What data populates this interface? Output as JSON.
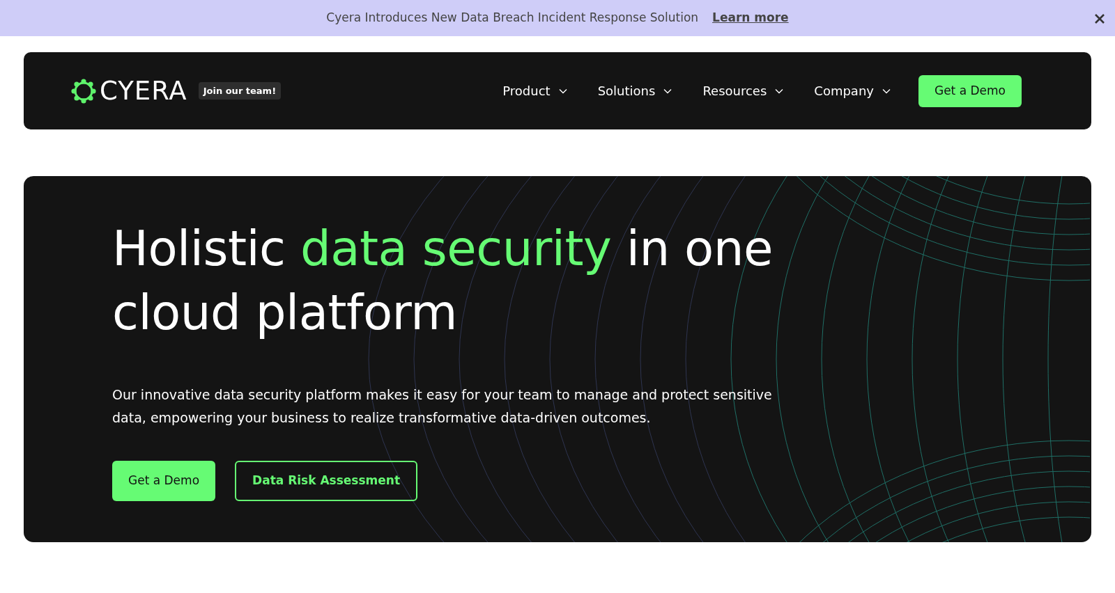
{
  "announcement": {
    "text": "Cyera Introduces New Data Breach Incident Response Solution",
    "link": "Learn more"
  },
  "nav": {
    "logo": "CYERA",
    "badge": "Join our team!",
    "items": [
      {
        "label": "Product"
      },
      {
        "label": "Solutions"
      },
      {
        "label": "Resources"
      },
      {
        "label": "Company"
      }
    ],
    "cta": "Get a Demo"
  },
  "hero": {
    "headline": [
      {
        "text": "Holistic ",
        "highlight": false
      },
      {
        "text": "data security",
        "highlight": true
      },
      {
        "text": " in one cloud platform",
        "highlight": false
      }
    ],
    "description": "Our innovative data security platform makes it easy for your team to manage and protect sensitive data, empowering your business to realize transformative data-driven outcomes.",
    "buttons": [
      {
        "label": "Get a Demo",
        "kind": "primary"
      },
      {
        "label": "Data Risk Assessment",
        "kind": "outline"
      }
    ]
  }
}
